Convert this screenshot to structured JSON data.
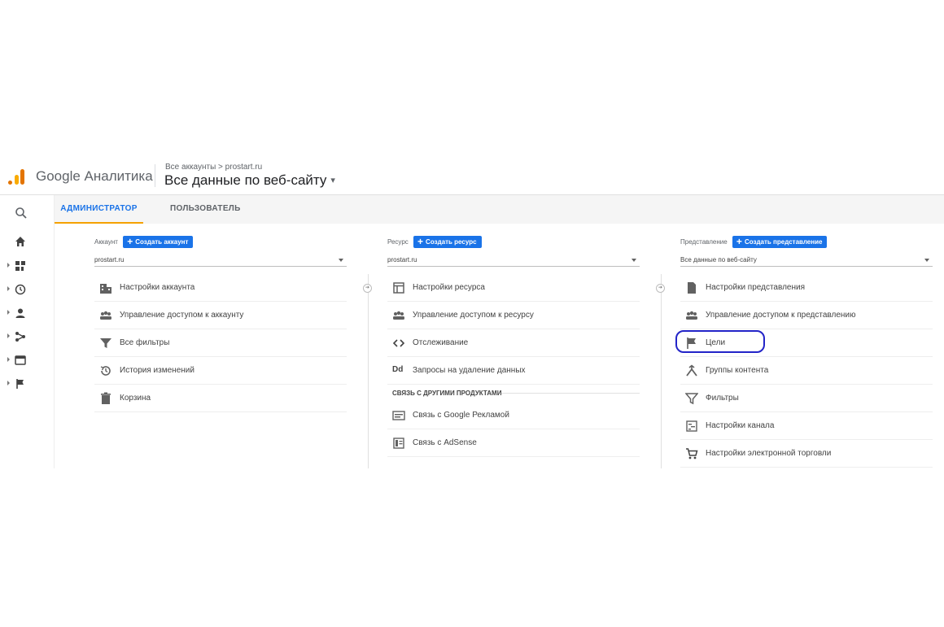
{
  "header": {
    "app_name": "Google Аналитика",
    "breadcrumb": "Все аккаунты > prostart.ru",
    "view_title": "Все данные по веб-сайту",
    "caret": "▾"
  },
  "rail": {
    "icons": [
      "search-icon",
      "home-icon",
      "dashboard-icon",
      "clock-icon",
      "person-icon",
      "acquisition-icon",
      "behavior-icon",
      "flag-icon"
    ]
  },
  "tabs": [
    {
      "label": "АДМИНИСТРАТОР",
      "active": true
    },
    {
      "label": "ПОЛЬЗОВАТЕЛЬ",
      "active": false
    }
  ],
  "columns": {
    "account": {
      "label": "Аккаунт",
      "button": "Создать аккаунт",
      "selected": "prostart.ru",
      "items": [
        {
          "label": "Настройки аккаунта",
          "icon": "building-icon"
        },
        {
          "label": "Управление доступом к аккаунту",
          "icon": "people-icon"
        },
        {
          "label": "Все фильтры",
          "icon": "filter-icon"
        },
        {
          "label": "История изменений",
          "icon": "history-icon"
        },
        {
          "label": "Корзина",
          "icon": "trash-icon"
        }
      ]
    },
    "property": {
      "label": "Ресурс",
      "button": "Создать ресурс",
      "selected": "prostart.ru",
      "items": [
        {
          "label": "Настройки ресурса",
          "icon": "window-icon"
        },
        {
          "label": "Управление доступом к ресурсу",
          "icon": "people-icon"
        },
        {
          "label": "Отслеживание",
          "icon": "code-icon"
        },
        {
          "label": "Запросы на удаление данных",
          "icon": "dd-icon",
          "glyph": "Dd"
        }
      ],
      "section_title": "СВЯЗЬ С ДРУГИМИ ПРОДУКТАМИ",
      "links": [
        {
          "label": "Связь с Google Рекламой",
          "icon": "ads-icon"
        },
        {
          "label": "Связь с AdSense",
          "icon": "adsense-icon"
        }
      ]
    },
    "view": {
      "label": "Представление",
      "button": "Создать представление",
      "selected": "Все данные по веб-сайту",
      "items": [
        {
          "label": "Настройки представления",
          "icon": "document-icon"
        },
        {
          "label": "Управление доступом к представлению",
          "icon": "people-icon"
        },
        {
          "label": "Цели",
          "icon": "flag-icon"
        },
        {
          "label": "Группы контента",
          "icon": "content-group-icon"
        },
        {
          "label": "Фильтры",
          "icon": "filter-icon"
        },
        {
          "label": "Настройки канала",
          "icon": "channel-icon"
        },
        {
          "label": "Настройки электронной торговли",
          "icon": "cart-icon"
        }
      ]
    }
  },
  "colors": {
    "accent": "#1a73e8",
    "tab_underline": "#f4a100",
    "highlight": "#2324c8"
  }
}
